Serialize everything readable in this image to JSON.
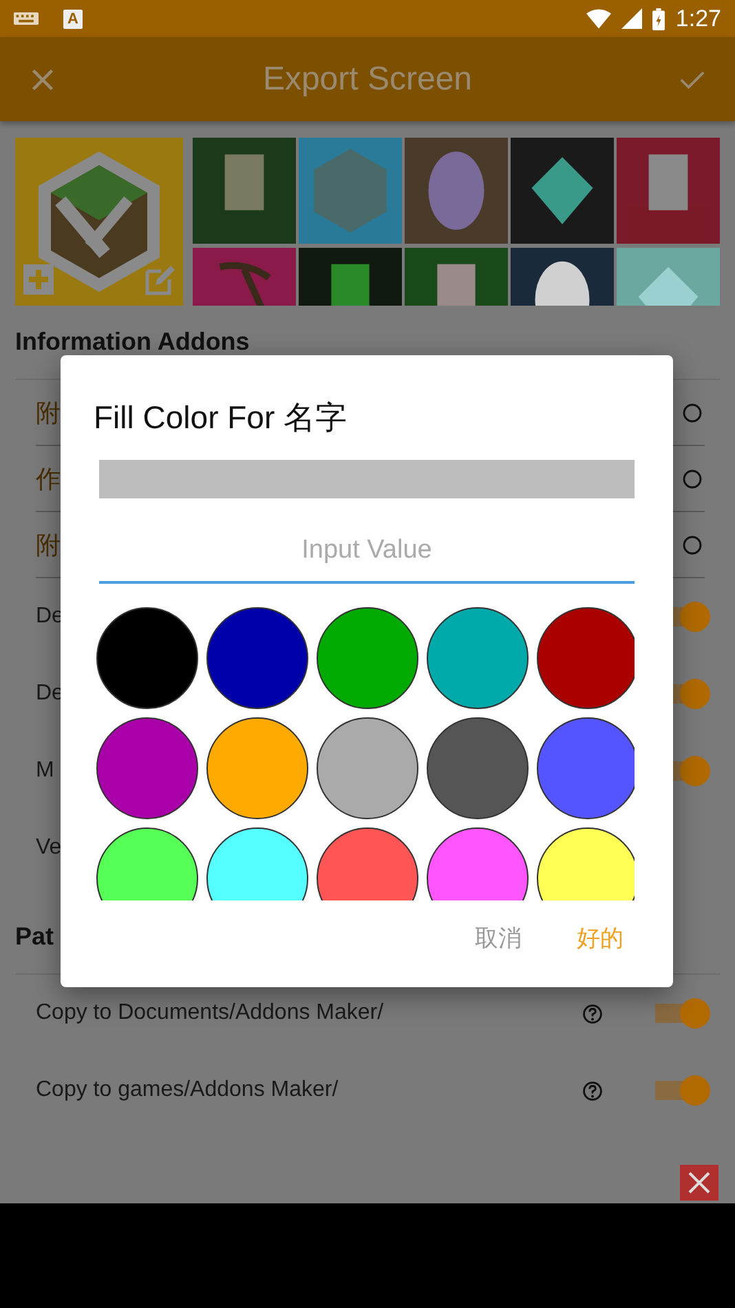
{
  "status_bar": {
    "notification": "A",
    "time": "1:27"
  },
  "app_bar": {
    "title": "Export Screen"
  },
  "info_section": {
    "title": "Information Addons",
    "rows": [
      {
        "kind": "field",
        "label": "附"
      },
      {
        "kind": "field",
        "label": "作"
      },
      {
        "kind": "field",
        "label": "附"
      },
      {
        "kind": "switch",
        "label": "De",
        "on": true
      },
      {
        "kind": "switch",
        "label": "De",
        "on": true
      },
      {
        "kind": "switch",
        "label": "M",
        "on": true
      },
      {
        "kind": "text",
        "label": "Ve"
      }
    ]
  },
  "path_section": {
    "title": "Pat",
    "rows": [
      {
        "label": "Copy to Documents/Addons Maker/",
        "on": true
      },
      {
        "label": "Copy to games/Addons Maker/",
        "on": true
      }
    ]
  },
  "dialog": {
    "title": "Fill Color For 名字",
    "input": {
      "placeholder": "Input Value"
    },
    "swatches": [
      {
        "color": "#000000"
      },
      {
        "color": "#0000aa"
      },
      {
        "color": "#00aa00"
      },
      {
        "color": "#00aaaa"
      },
      {
        "color": "#aa0000"
      },
      {
        "color": "#aa00aa"
      },
      {
        "color": "#ffaa00"
      },
      {
        "color": "#aaaaaa"
      },
      {
        "color": "#555555"
      },
      {
        "color": "#5555ff"
      },
      {
        "color": "#55ff55"
      },
      {
        "color": "#55ffff"
      },
      {
        "color": "#ff5555"
      },
      {
        "color": "#ff55ff"
      },
      {
        "color": "#ffff55"
      }
    ],
    "buttons": [
      {
        "kind": "cancel",
        "label": "取消"
      },
      {
        "kind": "confirm",
        "label": "好的"
      }
    ]
  }
}
